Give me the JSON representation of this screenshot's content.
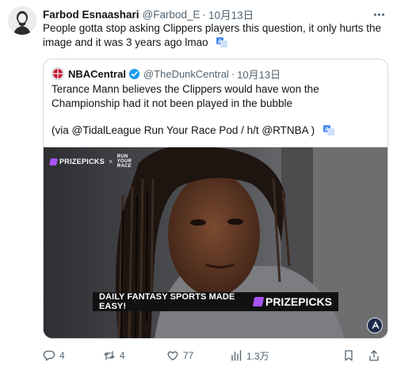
{
  "tweet": {
    "author_name": "Farbod Esnaashari",
    "author_handle": "@Farbod_E",
    "separator": "·",
    "date": "10月13日",
    "text": "People gotta stop asking Clippers players this question, it only hurts the image and it was 3 years ago lmao"
  },
  "quote": {
    "author_name": "NBACentral",
    "author_handle": "@TheDunkCentral",
    "separator": "·",
    "date": "10月13日",
    "text": "Terance Mann believes the Clippers would have won the Championship had it not been played in the bubble",
    "credit": "(via @TidalLeague Run Your Race Pod / h/t @RTNBA )"
  },
  "video": {
    "brand": "PRIZEPICKS",
    "collab_x": "×",
    "collab_line1": "RUN",
    "collab_line2": "YOUR",
    "collab_line3": "RACE",
    "banner_text": "DAILY FANTASY SPORTS MADE EASY!",
    "banner_brand": "PRIZEPICKS"
  },
  "actions": {
    "replies": "4",
    "retweets": "4",
    "likes": "77",
    "views": "1.3万"
  },
  "colors": {
    "text": "#0f1419",
    "secondary": "#536471",
    "verified": "#1d9bf0",
    "prizepicks": "#a855f7"
  },
  "icons": [
    "more-icon",
    "translate-icon",
    "verified-icon",
    "reply-icon",
    "retweet-icon",
    "like-icon",
    "views-icon",
    "bookmark-icon",
    "share-icon"
  ]
}
